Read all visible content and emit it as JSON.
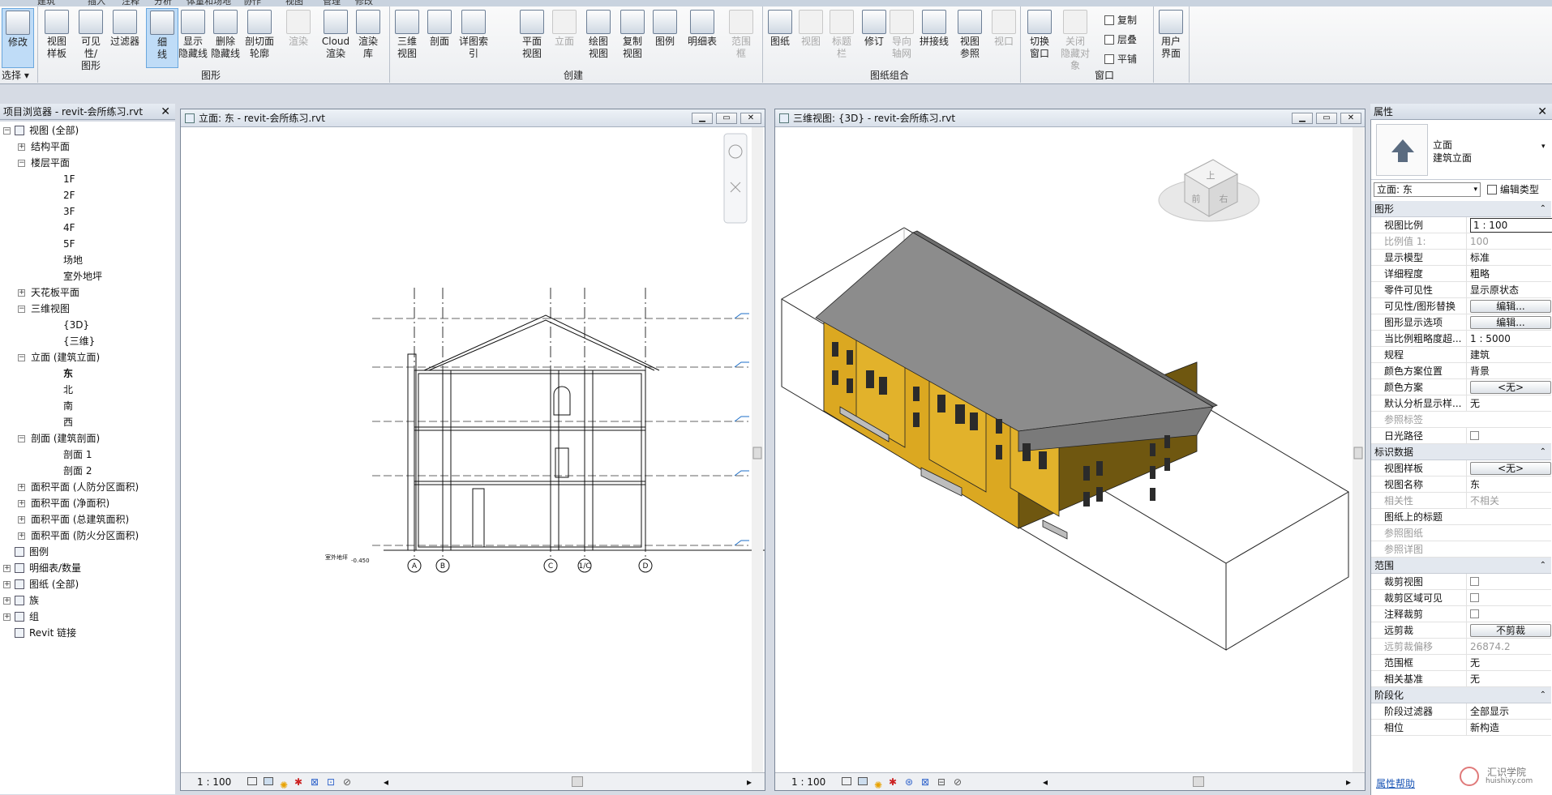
{
  "ribbon": {
    "tabs": [
      "建筑",
      "插入",
      "注释",
      "分析",
      "体量和场地",
      "协作",
      "视图",
      "管理",
      "修改"
    ],
    "modify": {
      "label": "修改",
      "select_label": "选择"
    },
    "graphics_group": {
      "label": "图形",
      "buttons": [
        "视图\n样板",
        "可见性/\n图形",
        "过滤器",
        "细\n线",
        "显示\n隐藏线",
        "删除\n隐藏线",
        "剖切面\n轮廓",
        "渲染",
        "Cloud\n渲染",
        "渲染\n库"
      ]
    },
    "create_group": {
      "label": "创建",
      "buttons": [
        "三维\n视图",
        "剖面",
        "详图索引",
        "平面\n视图",
        "立面",
        "绘图\n视图",
        "复制\n视图",
        "图例",
        "明细表",
        "范围\n框"
      ]
    },
    "sheet_group": {
      "label": "图纸组合",
      "buttons": [
        "图纸",
        "视图",
        "标题\n栏",
        "修订",
        "导向\n轴网",
        "拼接线",
        "视图\n参照",
        "视口"
      ]
    },
    "window_group": {
      "label": "窗口",
      "buttons": [
        "切换\n窗口",
        "关闭\n隐藏对象"
      ],
      "small": [
        "复制",
        "层叠",
        "平铺"
      ],
      "user_interface": "用户\n界面"
    }
  },
  "browser": {
    "title": "项目浏览器 - revit-会所练习.rvt",
    "items": [
      {
        "text": "视图 (全部)",
        "level": 0,
        "toggle": "-",
        "icon": "views-icon"
      },
      {
        "text": "结构平面",
        "level": 1,
        "toggle": "+"
      },
      {
        "text": "楼层平面",
        "level": 1,
        "toggle": "-"
      },
      {
        "text": "1F",
        "level": 2
      },
      {
        "text": "2F",
        "level": 2
      },
      {
        "text": "3F",
        "level": 2
      },
      {
        "text": "4F",
        "level": 2
      },
      {
        "text": "5F",
        "level": 2
      },
      {
        "text": "场地",
        "level": 2
      },
      {
        "text": "室外地坪",
        "level": 2
      },
      {
        "text": "天花板平面",
        "level": 1,
        "toggle": "+"
      },
      {
        "text": "三维视图",
        "level": 1,
        "toggle": "-"
      },
      {
        "text": "{3D}",
        "level": 2
      },
      {
        "text": "{三维}",
        "level": 2
      },
      {
        "text": "立面 (建筑立面)",
        "level": 1,
        "toggle": "-"
      },
      {
        "text": "东",
        "level": 2,
        "bold": true
      },
      {
        "text": "北",
        "level": 2
      },
      {
        "text": "南",
        "level": 2
      },
      {
        "text": "西",
        "level": 2
      },
      {
        "text": "剖面 (建筑剖面)",
        "level": 1,
        "toggle": "-"
      },
      {
        "text": "剖面 1",
        "level": 2
      },
      {
        "text": "剖面 2",
        "level": 2
      },
      {
        "text": "面积平面 (人防分区面积)",
        "level": 1,
        "toggle": "+"
      },
      {
        "text": "面积平面 (净面积)",
        "level": 1,
        "toggle": "+"
      },
      {
        "text": "面积平面 (总建筑面积)",
        "level": 1,
        "toggle": "+"
      },
      {
        "text": "面积平面 (防火分区面积)",
        "level": 1,
        "toggle": "+"
      },
      {
        "text": "图例",
        "level": 0,
        "icon": "legend-icon"
      },
      {
        "text": "明细表/数量",
        "level": 0,
        "toggle": "+",
        "icon": "schedule-icon"
      },
      {
        "text": "图纸 (全部)",
        "level": 0,
        "toggle": "+",
        "icon": "sheets-icon"
      },
      {
        "text": "族",
        "level": 0,
        "toggle": "+",
        "icon": "families-icon"
      },
      {
        "text": "组",
        "level": 0,
        "toggle": "+",
        "icon": "groups-icon"
      },
      {
        "text": "Revit 链接",
        "level": 0,
        "icon": "link-icon"
      }
    ]
  },
  "view_elevation": {
    "title": "立面: 东 - revit-会所练习.rvt",
    "scale": "1 : 100",
    "grid_labels": [
      "A",
      "B",
      "C",
      "1/C",
      "D"
    ],
    "level_note": "室外地坪",
    "level_value": "-0.450"
  },
  "view_3d": {
    "title": "三维视图: {3D} - revit-会所练习.rvt",
    "scale": "1 : 100",
    "viewcube_faces": [
      "上",
      "前",
      "右"
    ]
  },
  "properties": {
    "title": "属性",
    "type_name": "立面",
    "type_sub": "建筑立面",
    "instance_selector": "立面: 东",
    "edit_type": "编辑类型",
    "sections": [
      {
        "name": "图形",
        "rows": [
          {
            "k": "视图比例",
            "v": "1 : 100",
            "kind": "input"
          },
          {
            "k": "比例值 1:",
            "v": "100",
            "dis": true
          },
          {
            "k": "显示模型",
            "v": "标准"
          },
          {
            "k": "详细程度",
            "v": "粗略"
          },
          {
            "k": "零件可见性",
            "v": "显示原状态"
          },
          {
            "k": "可见性/图形替换",
            "v": "编辑...",
            "kind": "button"
          },
          {
            "k": "图形显示选项",
            "v": "编辑...",
            "kind": "button"
          },
          {
            "k": "当比例粗略度超...",
            "v": "1 : 5000"
          },
          {
            "k": "规程",
            "v": "建筑"
          },
          {
            "k": "颜色方案位置",
            "v": "背景"
          },
          {
            "k": "颜色方案",
            "v": "<无>",
            "kind": "button"
          },
          {
            "k": "默认分析显示样...",
            "v": "无"
          },
          {
            "k": "参照标签",
            "v": "",
            "dis": true
          },
          {
            "k": "日光路径",
            "v": "",
            "kind": "check"
          }
        ]
      },
      {
        "name": "标识数据",
        "rows": [
          {
            "k": "视图样板",
            "v": "<无>",
            "kind": "button"
          },
          {
            "k": "视图名称",
            "v": "东"
          },
          {
            "k": "相关性",
            "v": "不相关",
            "dis": true
          },
          {
            "k": "图纸上的标题",
            "v": ""
          },
          {
            "k": "参照图纸",
            "v": "",
            "dis": true
          },
          {
            "k": "参照详图",
            "v": "",
            "dis": true
          }
        ]
      },
      {
        "name": "范围",
        "rows": [
          {
            "k": "裁剪视图",
            "v": "",
            "kind": "check"
          },
          {
            "k": "裁剪区域可见",
            "v": "",
            "kind": "check"
          },
          {
            "k": "注释裁剪",
            "v": "",
            "kind": "check"
          },
          {
            "k": "远剪裁",
            "v": "不剪裁",
            "kind": "button"
          },
          {
            "k": "远剪裁偏移",
            "v": "26874.2",
            "dis": true
          },
          {
            "k": "范围框",
            "v": "无"
          },
          {
            "k": "相关基准",
            "v": "无"
          }
        ]
      },
      {
        "name": "阶段化",
        "rows": [
          {
            "k": "阶段过滤器",
            "v": "全部显示"
          },
          {
            "k": "相位",
            "v": "新构造"
          }
        ]
      }
    ],
    "help_link": "属性帮助"
  },
  "watermark": {
    "name": "汇识学院",
    "url": "huishixy.com"
  },
  "colors": {
    "facade": "#d6a21a",
    "roof": "#8a8a8a",
    "accent": "#3b7fd0"
  }
}
